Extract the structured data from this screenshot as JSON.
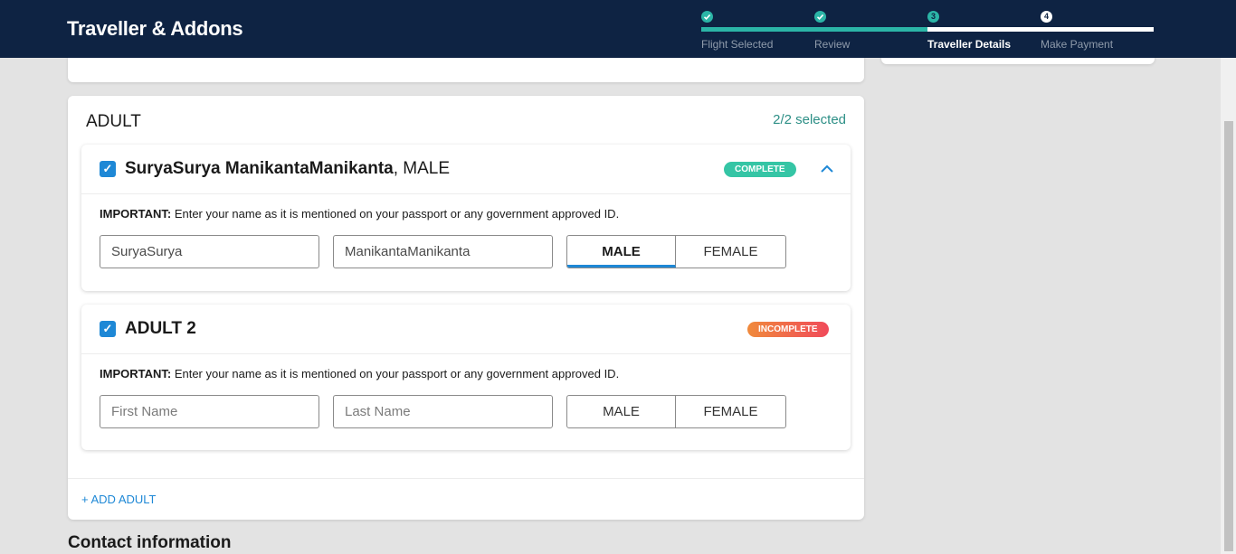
{
  "header": {
    "title": "Traveller & Addons",
    "progress_fraction": 0.5,
    "steps": [
      {
        "num": "",
        "label": "Flight Selected",
        "state": "done"
      },
      {
        "num": "",
        "label": "Review",
        "state": "done"
      },
      {
        "num": "3",
        "label": "Traveller Details",
        "state": "current"
      },
      {
        "num": "4",
        "label": "Make Payment",
        "state": "todo"
      }
    ]
  },
  "adult_section": {
    "title": "ADULT",
    "selected_count": "2/2 selected",
    "add_label": "+ ADD ADULT"
  },
  "travellers": [
    {
      "checked": true,
      "name": "SuryaSurya ManikantaManikanta",
      "gender_suffix": ", MALE",
      "status": "COMPLETE",
      "important_label": "IMPORTANT:",
      "important_text": " Enter your name as it is mentioned on your passport or any government approved ID.",
      "first_name_value": "SuryaSurya",
      "last_name_value": "ManikantaManikanta",
      "male_label": "MALE",
      "female_label": "FEMALE",
      "selected_gender": "MALE"
    },
    {
      "checked": true,
      "name": "ADULT 2",
      "gender_suffix": "",
      "status": "INCOMPLETE",
      "important_label": "IMPORTANT:",
      "important_text": " Enter your name as it is mentioned on your passport or any government approved ID.",
      "first_name_placeholder": "First Name",
      "last_name_placeholder": "Last Name",
      "male_label": "MALE",
      "female_label": "FEMALE",
      "selected_gender": ""
    }
  ],
  "contact": {
    "title": "Contact information"
  },
  "icons": {
    "checkbox": "checkbox-checked-icon",
    "collapse": "chevron-up-icon",
    "step_done": "check-icon"
  },
  "colors": {
    "header_bg": "#0e2343",
    "accent_teal": "#2bb5a7",
    "link_blue": "#1e88d6",
    "complete": "#35c5a5",
    "incomplete": "#f04a5a"
  }
}
